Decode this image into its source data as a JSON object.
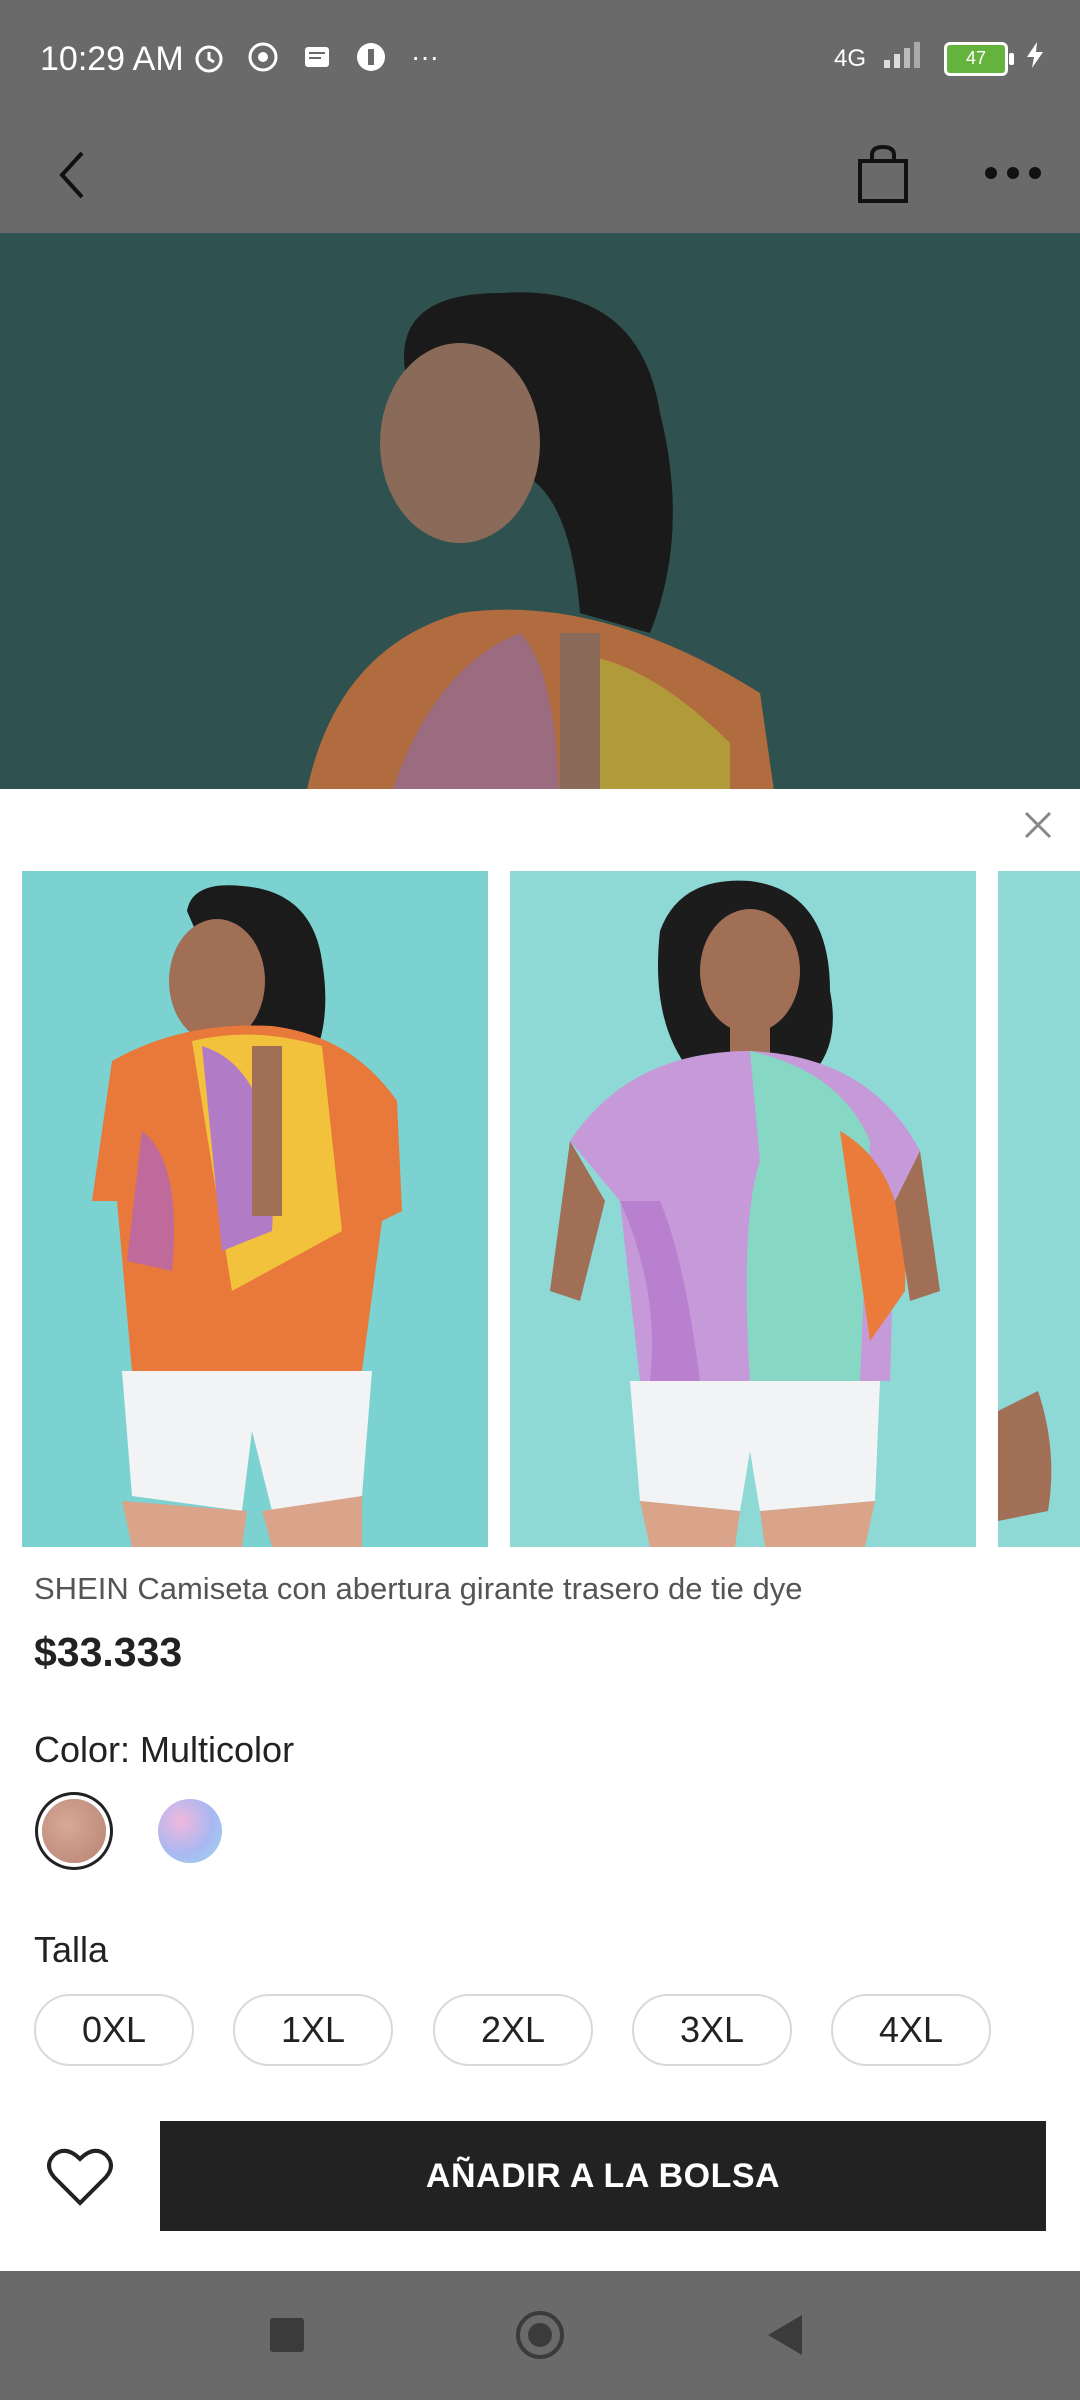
{
  "status_bar": {
    "time": "10:29 AM",
    "network": "4G",
    "battery": "47",
    "more_glyph": "···"
  },
  "nav": {
    "back_icon": "chevron-left-icon",
    "bag_icon": "shopping-bag-icon",
    "more_icon": "more-horizontal-icon"
  },
  "product": {
    "title": "SHEIN Camiseta con abertura girante trasero de tie dye",
    "price": "$33.333",
    "color_label": "Color: Multicolor",
    "colors": [
      "#c79a86",
      "#b9b7f0"
    ],
    "size_label": "Talla",
    "sizes": [
      "0XL",
      "1XL",
      "2XL",
      "3XL",
      "4XL"
    ]
  },
  "actions": {
    "add_to_bag": "AÑADIR A LA BOLSA"
  },
  "colors": {
    "accent": "#222222",
    "overlay": "#6a6a6a",
    "gallery_bg": "#7bd2d1"
  }
}
